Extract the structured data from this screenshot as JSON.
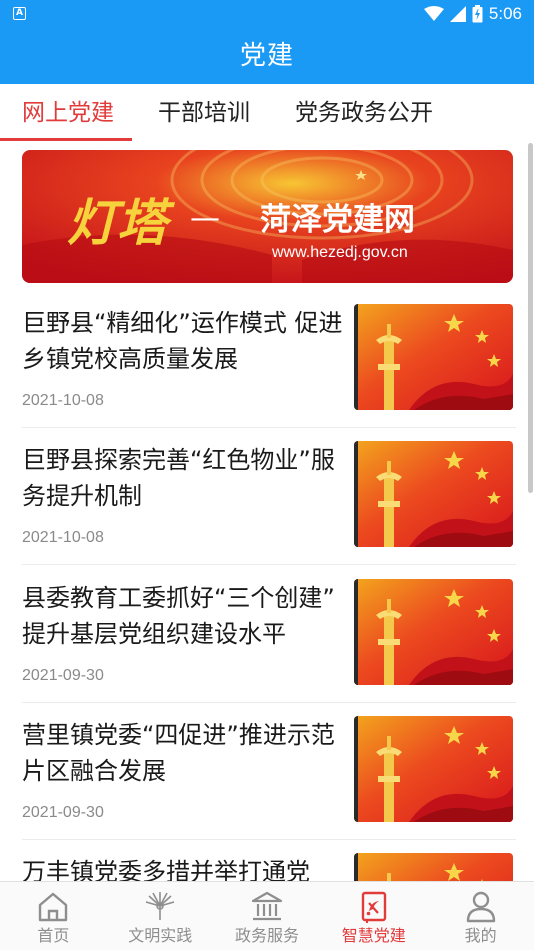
{
  "status_bar": {
    "time": "5:06",
    "app_badge": "A"
  },
  "app_bar": {
    "title": "党建"
  },
  "tabs": [
    {
      "label": "网上党建",
      "active": true
    },
    {
      "label": "干部培训",
      "active": false
    },
    {
      "label": "党务政务公开",
      "active": false
    }
  ],
  "banner": {
    "calligraphy": "灯塔",
    "dash": "—",
    "site_name": "菏泽党建网",
    "url": "www.hezedj.gov.cn"
  },
  "news": [
    {
      "title": "巨野县“精细化”运作模式 促进乡镇党校高质量发展",
      "date": "2021-10-08"
    },
    {
      "title": "巨野县探索完善“红色物业”服务提升机制",
      "date": "2021-10-08"
    },
    {
      "title": "县委教育工委抓好“三个创建” 提升基层党组织建设水平",
      "date": "2021-09-30"
    },
    {
      "title": "营里镇党委“四促进”推进示范片区融合发展",
      "date": "2021-09-30"
    },
    {
      "title": "万丰镇党委多措并举打通党",
      "date": ""
    }
  ],
  "bottom_nav": [
    {
      "label": "首页",
      "icon": "home-icon",
      "active": false
    },
    {
      "label": "文明实践",
      "icon": "peacock-icon",
      "active": false
    },
    {
      "label": "政务服务",
      "icon": "government-building-icon",
      "active": false
    },
    {
      "label": "智慧党建",
      "icon": "party-emblem-book-icon",
      "active": true
    },
    {
      "label": "我的",
      "icon": "user-icon",
      "active": false
    }
  ],
  "colors": {
    "primary": "#1a9af5",
    "accent_red": "#e23b3b",
    "inactive_gray": "#8e8e8e",
    "date_gray": "#8a8a8a"
  }
}
